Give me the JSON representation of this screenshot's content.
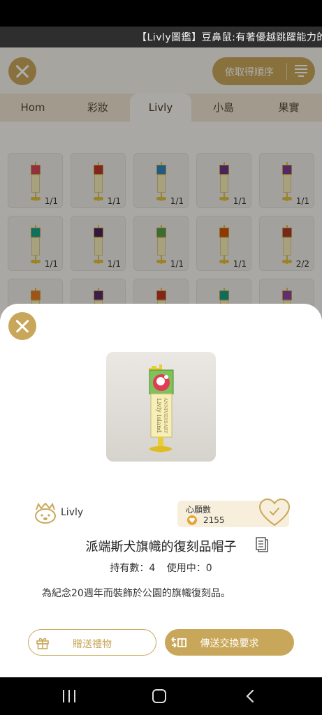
{
  "ticker": {
    "text": "【Livly圖鑑】豆鼻鼠:有著優越跳躍能力的"
  },
  "header": {
    "sort_label": "依取得順序"
  },
  "tabs": [
    {
      "label": "Hom",
      "active": false
    },
    {
      "label": "彩妝",
      "active": false
    },
    {
      "label": "Livly",
      "active": true
    },
    {
      "label": "小島",
      "active": false
    },
    {
      "label": "果實",
      "active": false
    }
  ],
  "grid": {
    "items": [
      {
        "count": "1/1",
        "color": "#d9475a"
      },
      {
        "count": "1/1",
        "color": "#c0392b"
      },
      {
        "count": "1/1",
        "color": "#2e86c1"
      },
      {
        "count": "1/1",
        "color": "#6c3483"
      },
      {
        "count": "1/1",
        "color": "#7d3c98"
      },
      {
        "count": "1/1",
        "color": "#17a589"
      },
      {
        "count": "1/1",
        "color": "#4a235a"
      },
      {
        "count": "1/1",
        "color": "#58a04b"
      },
      {
        "count": "1/1",
        "color": "#d35400"
      },
      {
        "count": "2/2",
        "color": "#b03a2e"
      },
      {
        "count": "",
        "color": "#e67e22"
      },
      {
        "count": "",
        "color": "#5b2c6f"
      },
      {
        "count": "",
        "color": "#c0392b"
      },
      {
        "count": "",
        "color": "#16a085"
      },
      {
        "count": "",
        "color": "#8e44ad"
      }
    ]
  },
  "sheet": {
    "brand": "Livly",
    "wish_label": "心願數",
    "wish_count": "2155",
    "title": "派端斯犬旗幟的復刻品帽子",
    "owned": "持有數：4",
    "in_use": "使用中：0",
    "description": "為紀念20週年而裝飾於公園的旗幟復刻品。",
    "gift_label": "贈送禮物",
    "trade_label": "傳送交換要求"
  },
  "colors": {
    "accent": "#c9a75a",
    "tab_bar": "#ede4d0"
  }
}
